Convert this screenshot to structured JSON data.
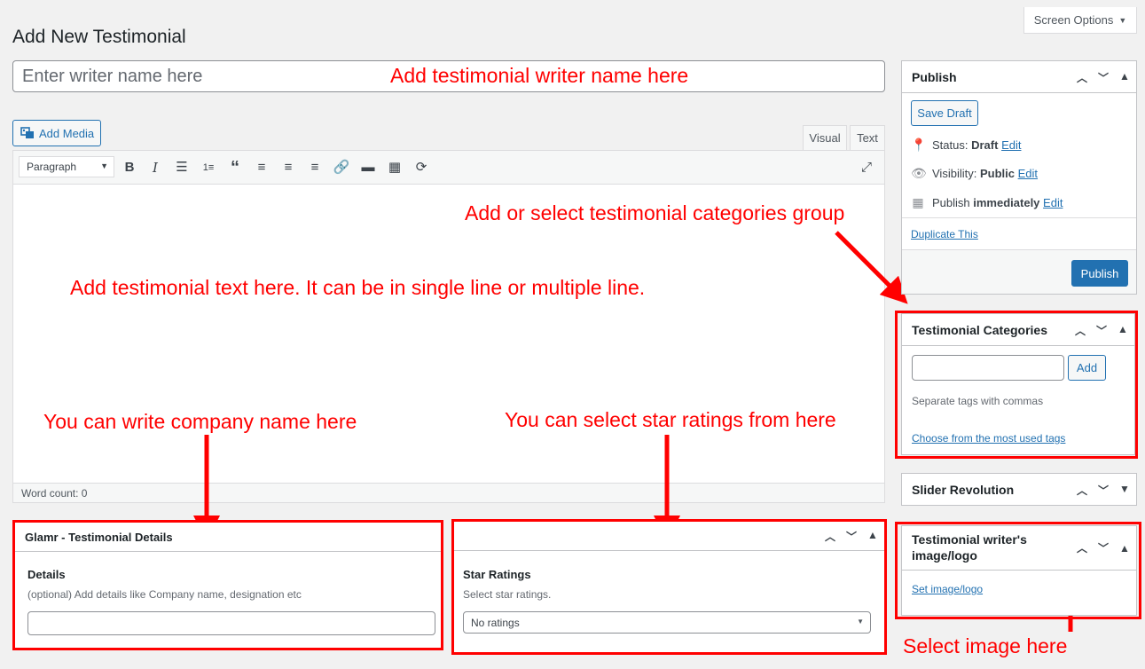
{
  "header": {
    "page_title": "Add New Testimonial",
    "screen_options": "Screen Options"
  },
  "title_field": {
    "placeholder": "Enter writer name here"
  },
  "editor": {
    "add_media": "Add Media",
    "tabs": [
      "Visual",
      "Text"
    ],
    "format_select": "Paragraph",
    "word_count": "Word count: 0"
  },
  "publish": {
    "title": "Publish",
    "save_draft": "Save Draft",
    "status_label": "Status:",
    "status_value": "Draft",
    "visibility_label": "Visibility:",
    "visibility_value": "Public",
    "publish_label": "Publish",
    "publish_value": "immediately",
    "edit": "Edit",
    "duplicate": "Duplicate This",
    "publish_button": "Publish"
  },
  "categories": {
    "title": "Testimonial Categories",
    "add_button": "Add",
    "help": "Separate tags with commas",
    "choose_link": "Choose from the most used tags"
  },
  "slider": {
    "title": "Slider Revolution"
  },
  "image_box": {
    "title_line1": "Testimonial writer's",
    "title_line2": "image/logo",
    "set_link": "Set image/logo"
  },
  "details_box": {
    "title": "Glamr - Testimonial Details",
    "label": "Details",
    "help": "(optional) Add details like Company name, designation etc"
  },
  "ratings_box": {
    "label": "Star Ratings",
    "help": "Select star ratings.",
    "selected": "No ratings"
  },
  "annotations": {
    "writer_name": "Add testimonial writer name here",
    "categories": "Add or select testimonial categories group",
    "text": "Add testimonial text here. It can be in single line or multiple line.",
    "company": "You can write company name here",
    "stars": "You can select star ratings from here",
    "image": "Select image here"
  },
  "colors": {
    "annotation": "#ff0000",
    "primary": "#2271b1"
  }
}
